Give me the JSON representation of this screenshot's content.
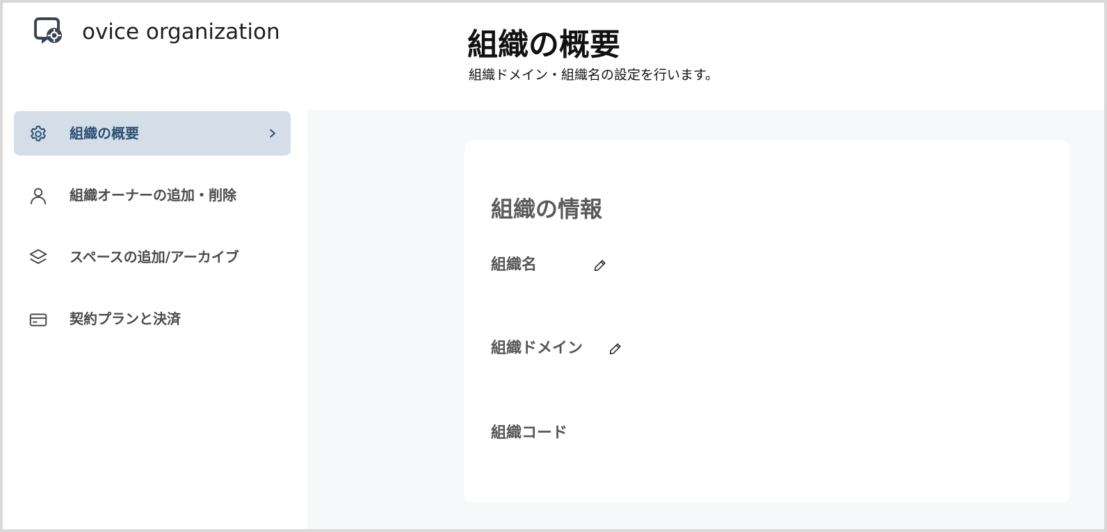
{
  "header": {
    "org_name": "ovice organization",
    "logo_icon": "ovice-logo-icon"
  },
  "page": {
    "title": "組織の概要",
    "subtitle": "組織ドメイン・組織名の設定を行います。"
  },
  "sidebar": {
    "items": [
      {
        "label": "組織の概要",
        "icon": "gear-icon",
        "active": true
      },
      {
        "label": "組織オーナーの追加・削除",
        "icon": "user-icon",
        "active": false
      },
      {
        "label": "スペースの追加/アーカイブ",
        "icon": "layers-icon",
        "active": false
      },
      {
        "label": "契約プランと決済",
        "icon": "credit-card-icon",
        "active": false
      }
    ]
  },
  "card": {
    "title": "組織の情報",
    "fields": [
      {
        "label": "組織名",
        "value": "",
        "editable": true
      },
      {
        "label": "組織ドメイン",
        "value": "",
        "editable": true
      },
      {
        "label": "組織コード",
        "value": "",
        "editable": false
      }
    ]
  },
  "colors": {
    "active_bg": "#d3dee8",
    "active_text": "#2d4e73",
    "content_bg": "#f7f8fa",
    "text_muted": "#555555"
  }
}
